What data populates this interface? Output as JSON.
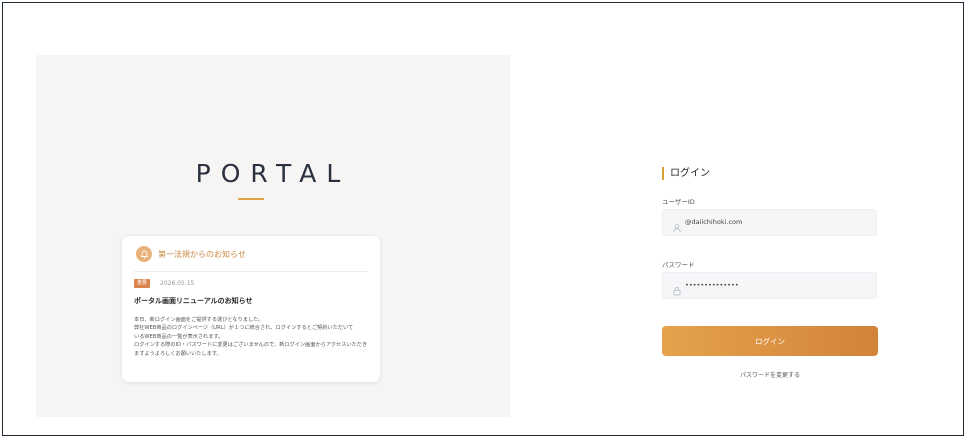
{
  "branding": {
    "logo_text": "PORTAL",
    "accent_color": "#e0a34a"
  },
  "notice": {
    "title": "第一法規からのお知らせ",
    "icon": "bell-icon",
    "badge": "重要",
    "date": "2026.05.15",
    "headline": "ポータル画面リニューアルのお知らせ",
    "body_lines": [
      "本日、新ログイン画面をご提供する運びとなりました。",
      "弊社WEB商品のログインページ（URL）が１つに統合され、ログインするとご契約いただいて",
      "いるWEB商品の一覧が表示されます。",
      "ログインする際のID・パスワードに変更はございませんので、新ログイン画面からアクセスいただき",
      "ますようよろしくお願いいたします。"
    ]
  },
  "login": {
    "heading": "ログイン",
    "user_id_label": "ユーザーID",
    "user_id_value": "@daiichihoki.com",
    "user_icon": "user-icon",
    "password_label": "パスワード",
    "password_value": "••••••••••••••",
    "lock_icon": "lock-icon",
    "submit_label": "ログイン",
    "change_password_link": "パスワードを変更する",
    "button_gradient": [
      "#e5a24b",
      "#d2843a"
    ]
  }
}
